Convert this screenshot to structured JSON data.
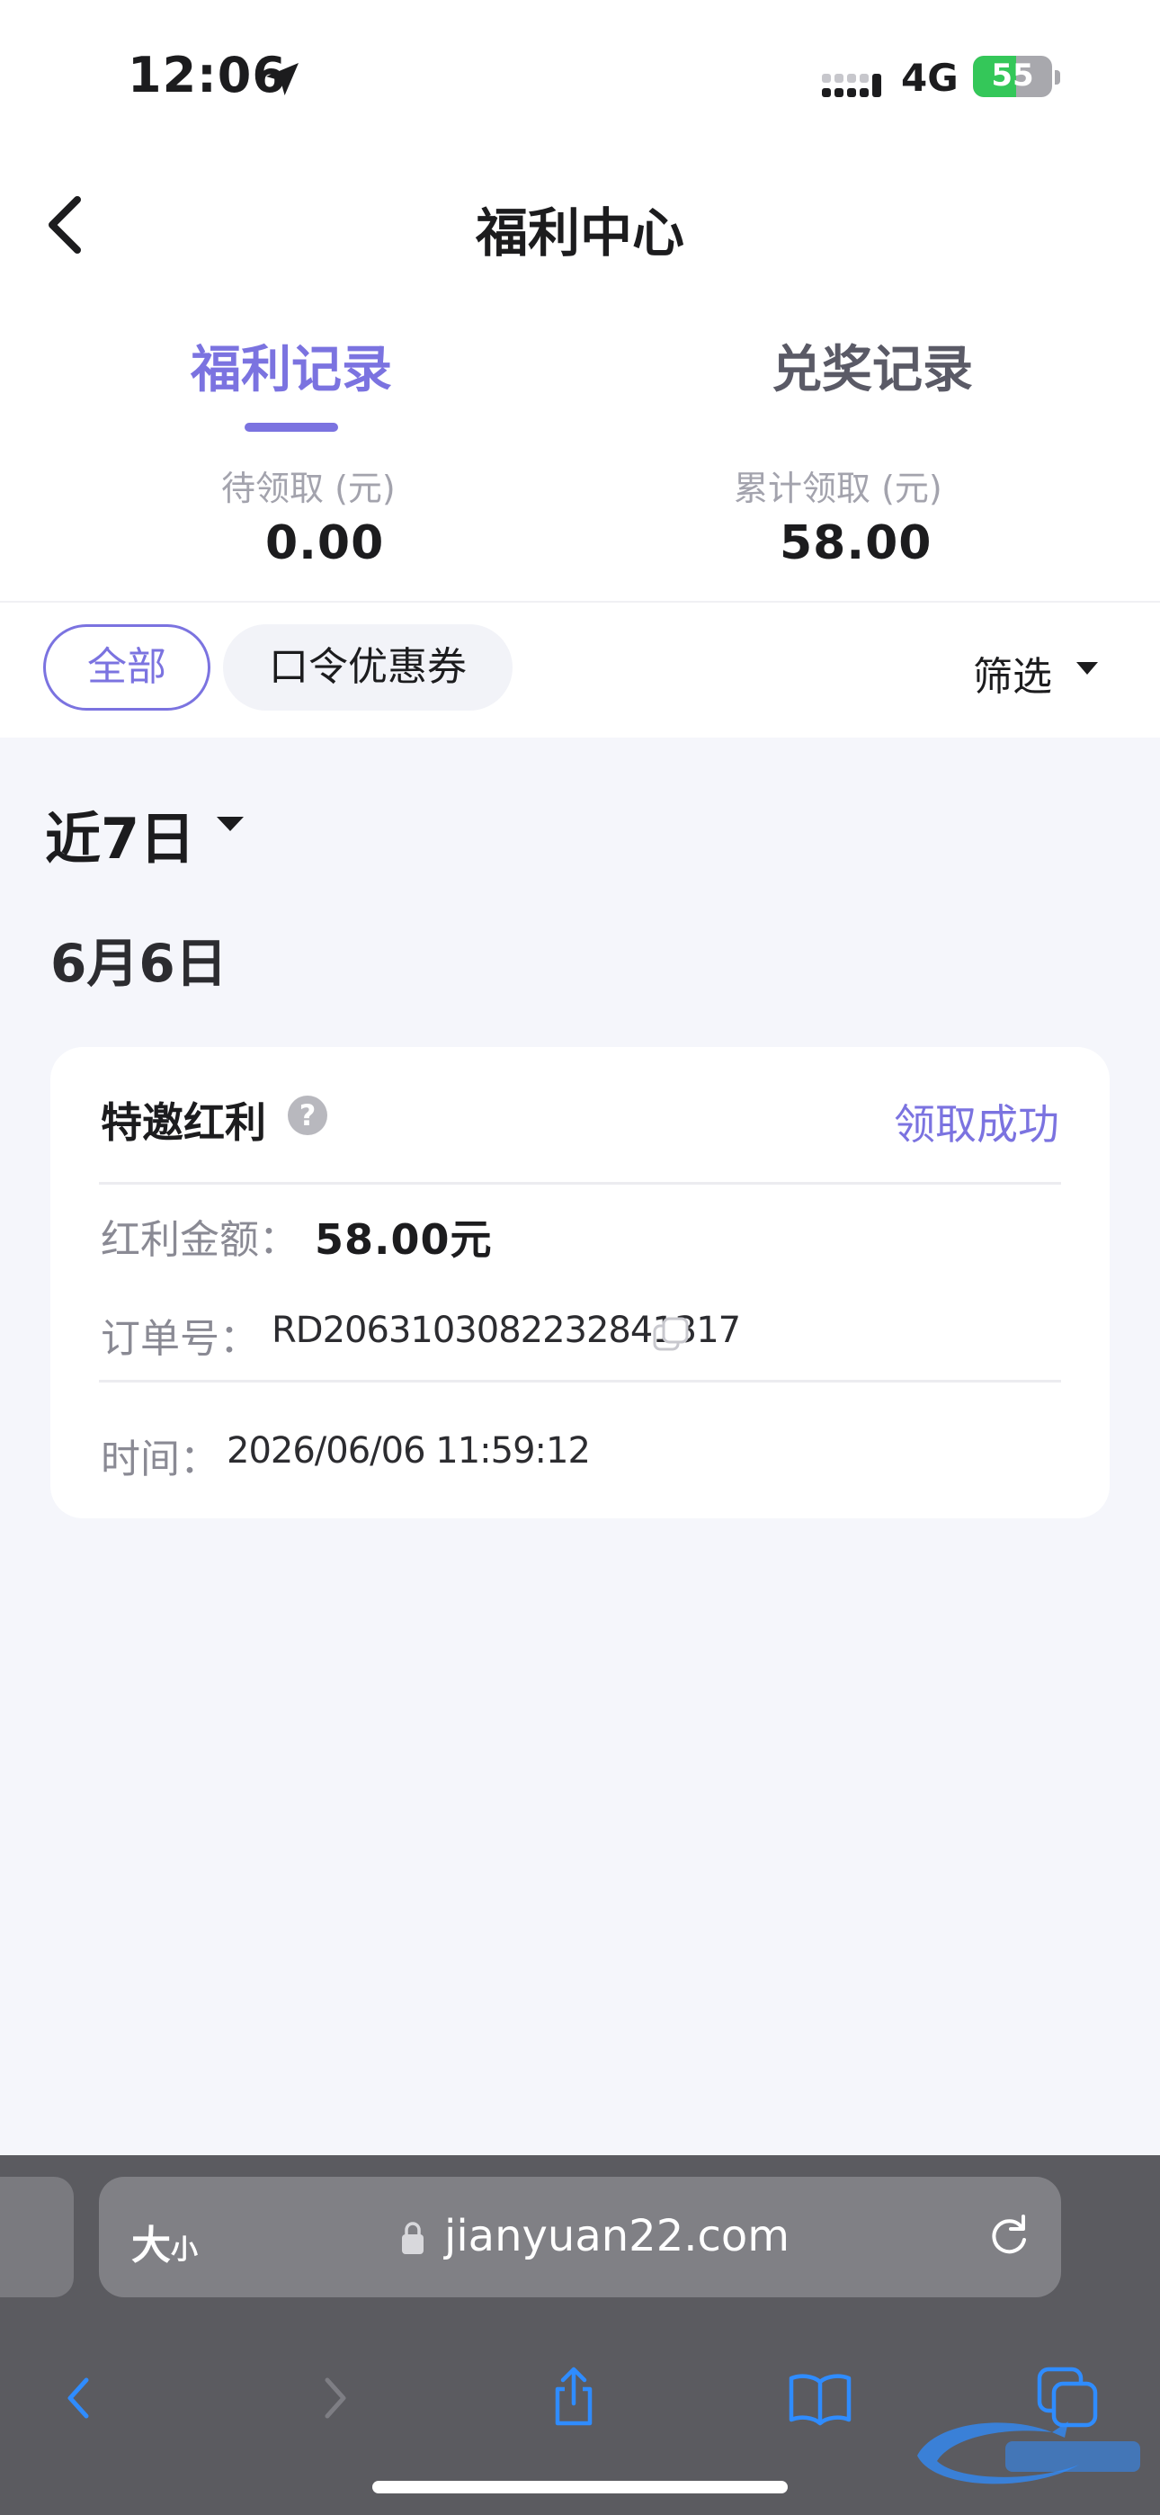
{
  "status_bar": {
    "time": "12:06",
    "network": "4G",
    "battery_percent": "55",
    "battery_level": 0.55,
    "icons": [
      "location-arrow-icon",
      "signal-dots-icon",
      "battery-charging-icon"
    ]
  },
  "nav": {
    "title": "福利中心",
    "back_icon": "chevron-left-icon"
  },
  "tabs": [
    {
      "label": "福利记录",
      "active": true
    },
    {
      "label": "兑奖记录",
      "active": false
    }
  ],
  "summary": {
    "pending_label": "待领取 (元)",
    "pending_value": "0.00",
    "total_label": "累计领取 (元)",
    "total_value": "58.00"
  },
  "filters": {
    "chips": [
      {
        "label": "全部",
        "selected": true
      },
      {
        "label": "口令优惠券",
        "selected": false
      }
    ],
    "filter_label": "筛选"
  },
  "range": {
    "label": "近7日"
  },
  "day_group": {
    "label": "6月6日"
  },
  "record": {
    "title": "特邀红利",
    "help_glyph": "?",
    "status": "领取成功",
    "amount_label": "红利金额：",
    "amount_value": "58.00元",
    "order_label": "订单号：",
    "order_value": "RD2063103082232841317",
    "time_label": "时间：",
    "time_value": "2026/06/06 11:59:12"
  },
  "browser": {
    "text_size_big": "大",
    "text_size_small": "小",
    "url": "jianyuan22.com"
  },
  "colors": {
    "accent": "#7B73E0",
    "page_bg": "#F5F6FB",
    "battery_green": "#34c759",
    "browser_bar": "#5b5b60",
    "browser_icon_blue": "#2f8cff"
  }
}
